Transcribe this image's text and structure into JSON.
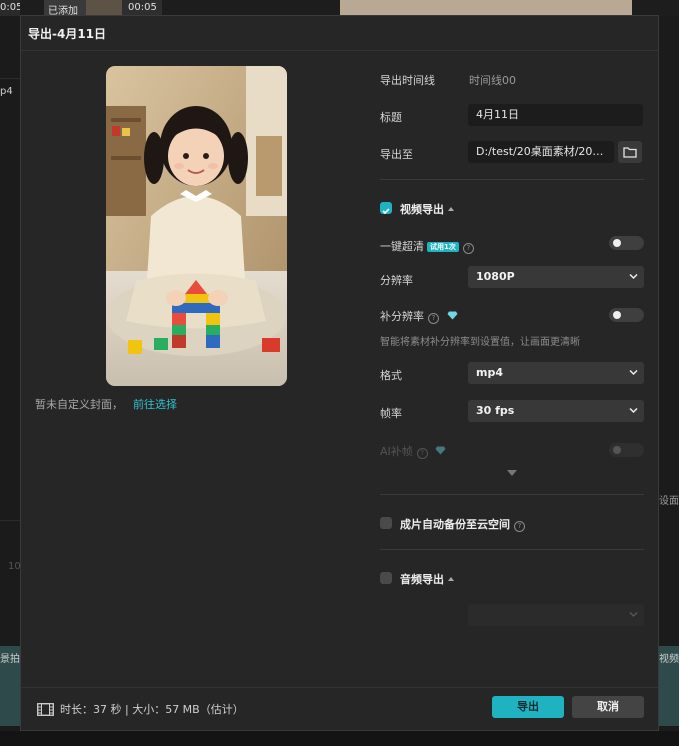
{
  "background": {
    "clip_time_1": "0:05",
    "clip_tag": "已添加",
    "clip_time_2": "00:05",
    "left_label_1": "p4",
    "left_label_2": "10",
    "left_label_3": "景拍",
    "right_label_1": "设面",
    "right_label_2": "视频"
  },
  "dialog": {
    "title": "导出-4月11日",
    "cover_note": "暂未自定义封面，",
    "cover_link": "前往选择",
    "timeline_label": "导出时间线",
    "timeline_value": "时间线00",
    "title_label": "标题",
    "title_value": "4月11日",
    "export_to_label": "导出至",
    "export_path": "D:/test/20桌面素材/202...",
    "video_section": "视频导出",
    "super_res_label": "一键超清",
    "super_res_badge": "试用1次",
    "resolution_label": "分辨率",
    "resolution_value": "1080P",
    "res_fill_label": "补分辨率",
    "res_fill_hint": "智能将素材补分辨率到设置值，让画面更清晰",
    "format_label": "格式",
    "format_value": "mp4",
    "framerate_label": "帧率",
    "framerate_value": "30 fps",
    "ai_frame_label": "AI补帧",
    "cloud_backup_label": "成片自动备份至云空间",
    "audio_section": "音频导出",
    "video_export_checked": true,
    "cloud_backup_checked": false,
    "audio_export_checked": false,
    "super_res_on": false,
    "res_fill_on": false,
    "ai_frame_on": false
  },
  "footer": {
    "duration_label": "时长：37 秒 | 大小：57 MB（估计）",
    "export_button": "导出",
    "cancel_button": "取消"
  },
  "colors": {
    "accent": "#1fb3c2",
    "dialog_bg": "#262626",
    "field_bg": "#1c1c1c",
    "select_bg": "#383838"
  },
  "icons": [
    "folder-icon",
    "check-icon",
    "help-icon",
    "diamond-icon",
    "chevron-down-icon",
    "film-icon"
  ]
}
